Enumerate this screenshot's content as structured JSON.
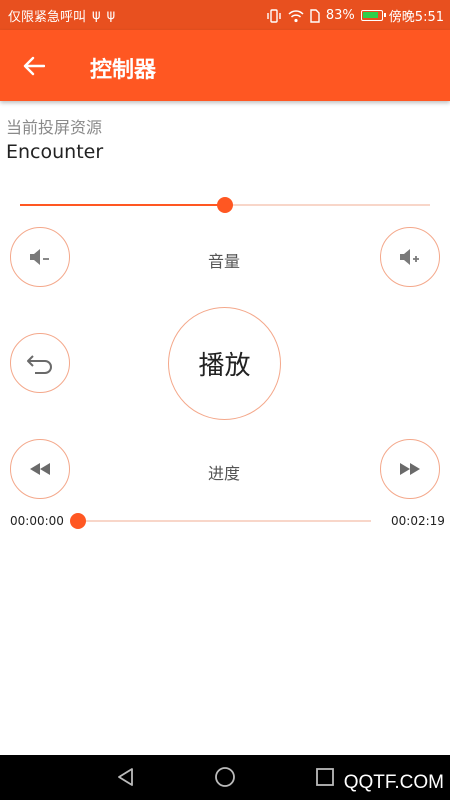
{
  "status_bar": {
    "left_text": "仅限紧急呼叫",
    "battery": "83%",
    "time": "傍晚5:51"
  },
  "app_bar": {
    "title": "控制器"
  },
  "source": {
    "label": "当前投屏资源",
    "name": "Encounter"
  },
  "volume": {
    "label": "音量",
    "level": 0.5
  },
  "playback": {
    "play_label": "播放"
  },
  "progress": {
    "label": "进度",
    "current_time": "00:00:00",
    "total_time": "00:02:19",
    "position": 0.0
  },
  "watermark": "QQTF.COM",
  "colors": {
    "accent": "#ff5722",
    "status_bar": "#e8501f",
    "track_light": "#f8d6c9",
    "button_border": "#f4a88b"
  },
  "icons": {
    "back": "arrow-left-icon",
    "volume_down": "volume-down-icon",
    "volume_up": "volume-up-icon",
    "undo": "undo-icon",
    "rewind": "rewind-icon",
    "fast_forward": "fast-forward-icon"
  }
}
